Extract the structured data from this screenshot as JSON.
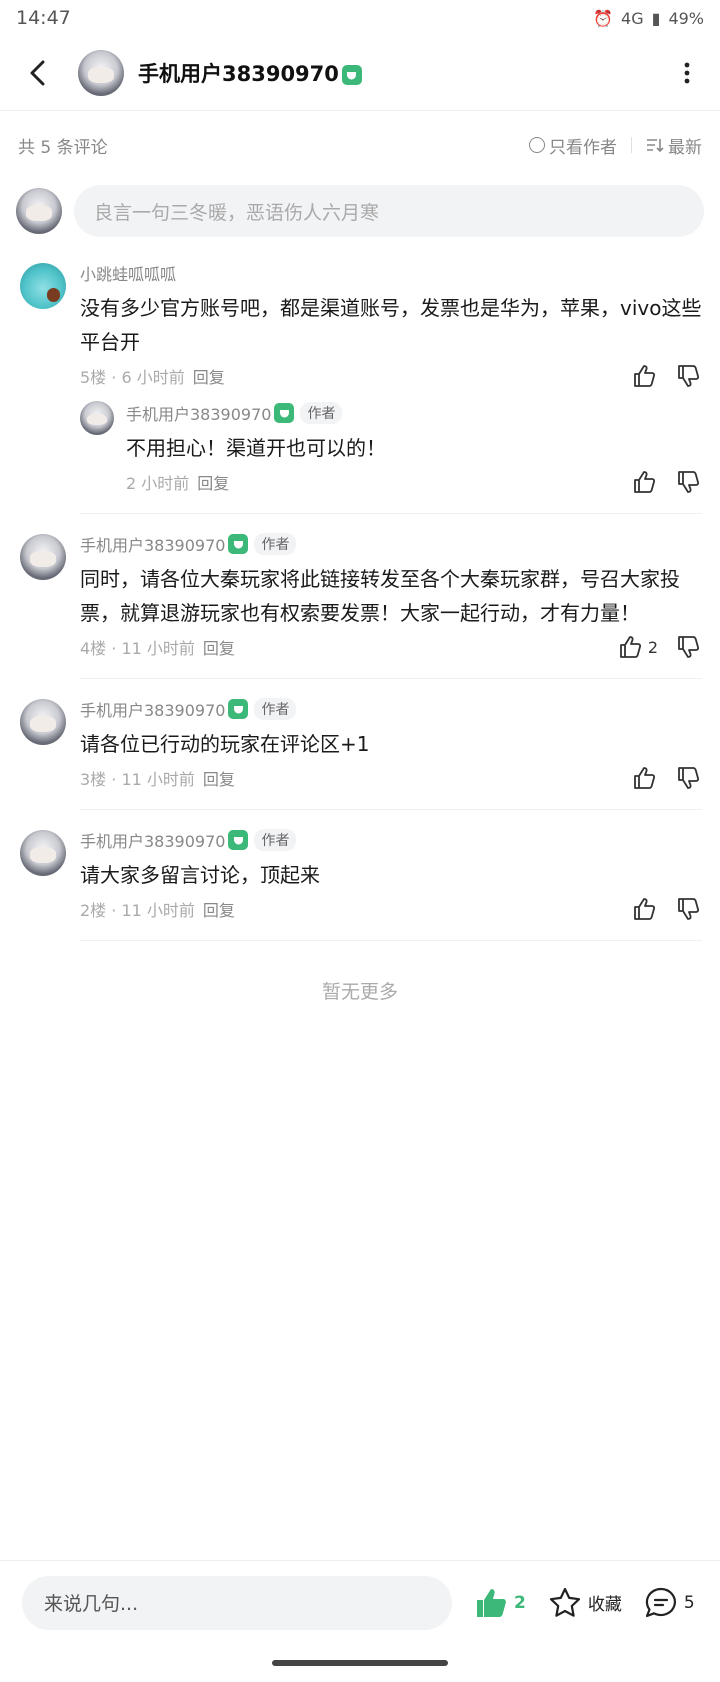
{
  "status_bar": {
    "time": "14:47",
    "network": "4G",
    "battery": "49%"
  },
  "header": {
    "title": "手机用户38390970"
  },
  "filter": {
    "count_label": "共 5 条评论",
    "only_author": "只看作者",
    "sort": "最新"
  },
  "input": {
    "placeholder": "良言一句三冬暖，恶语伤人六月寒"
  },
  "comments": [
    {
      "user": "小跳蛙呱呱呱",
      "text": "没有多少官方账号吧，都是渠道账号，发票也是华为，苹果，vivo这些平台开",
      "meta": "5楼 · 6 小时前",
      "reply": "回复",
      "reply_item": {
        "user": "手机用户38390970",
        "author_tag": "作者",
        "text": "不用担心！渠道开也可以的！",
        "meta": "2 小时前",
        "reply": "回复"
      }
    },
    {
      "user": "手机用户38390970",
      "author_tag": "作者",
      "text": "同时，请各位大秦玩家将此链接转发至各个大秦玩家群，号召大家投票，就算退游玩家也有权索要发票！大家一起行动，才有力量！",
      "meta": "4楼 · 11 小时前",
      "reply": "回复",
      "likes": "2"
    },
    {
      "user": "手机用户38390970",
      "author_tag": "作者",
      "text": "请各位已行动的玩家在评论区+1",
      "meta": "3楼 · 11 小时前",
      "reply": "回复"
    },
    {
      "user": "手机用户38390970",
      "author_tag": "作者",
      "text": "请大家多留言讨论，顶起来",
      "meta": "2楼 · 11 小时前",
      "reply": "回复"
    }
  ],
  "no_more": "暂无更多",
  "bottom_bar": {
    "placeholder": "来说几句...",
    "likes": "2",
    "favorite": "收藏",
    "comments": "5"
  },
  "colors": {
    "accent": "#3cb878",
    "muted": "#aaaaaa"
  },
  "icons": [
    "back-arrow-icon",
    "more-vertical-icon",
    "thumb-up-icon",
    "thumb-down-icon",
    "star-icon",
    "comment-bubble-icon",
    "sort-icon",
    "verified-badge-icon"
  ]
}
